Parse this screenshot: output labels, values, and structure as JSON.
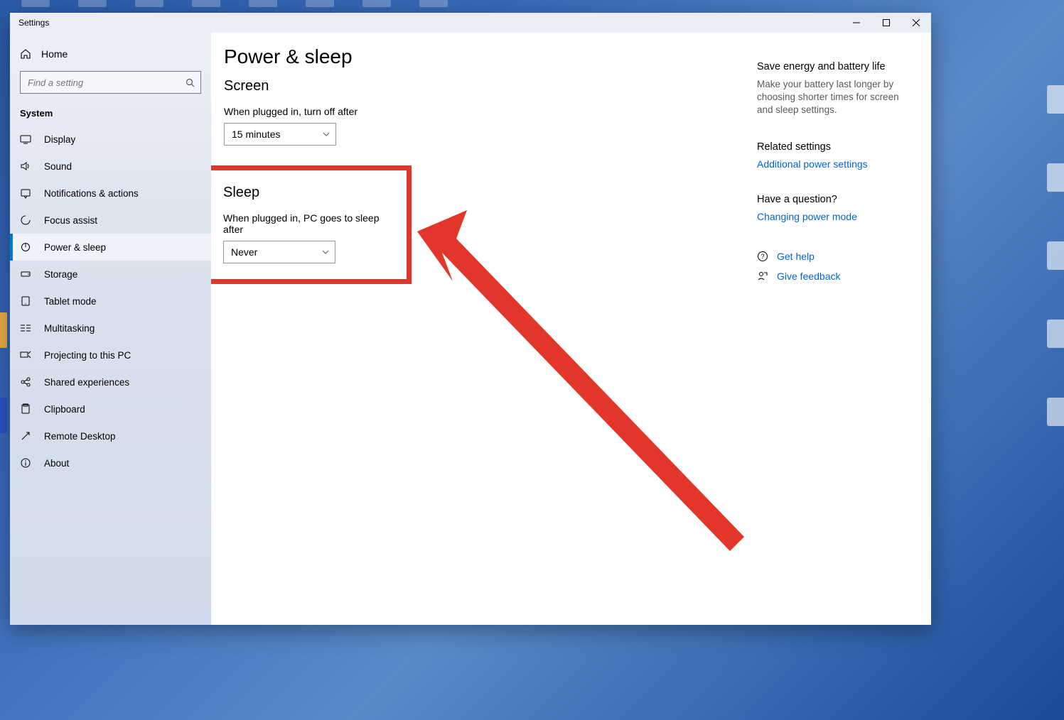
{
  "window": {
    "title": "Settings"
  },
  "sidebar": {
    "home": "Home",
    "search_placeholder": "Find a setting",
    "section": "System",
    "items": [
      {
        "label": "Display"
      },
      {
        "label": "Sound"
      },
      {
        "label": "Notifications & actions"
      },
      {
        "label": "Focus assist"
      },
      {
        "label": "Power & sleep"
      },
      {
        "label": "Storage"
      },
      {
        "label": "Tablet mode"
      },
      {
        "label": "Multitasking"
      },
      {
        "label": "Projecting to this PC"
      },
      {
        "label": "Shared experiences"
      },
      {
        "label": "Clipboard"
      },
      {
        "label": "Remote Desktop"
      },
      {
        "label": "About"
      }
    ]
  },
  "main": {
    "page_title": "Power & sleep",
    "screen": {
      "heading": "Screen",
      "label": "When plugged in, turn off after",
      "value": "15 minutes"
    },
    "sleep": {
      "heading": "Sleep",
      "label": "When plugged in, PC goes to sleep after",
      "value": "Never"
    }
  },
  "right": {
    "energy_head": "Save energy and battery life",
    "energy_text": "Make your battery last longer by choosing shorter times for screen and sleep settings.",
    "related_head": "Related settings",
    "related_link": "Additional power settings",
    "question_head": "Have a question?",
    "question_link": "Changing power mode",
    "help": "Get help",
    "feedback": "Give feedback"
  },
  "annotation": {
    "color": "#e3362b"
  }
}
